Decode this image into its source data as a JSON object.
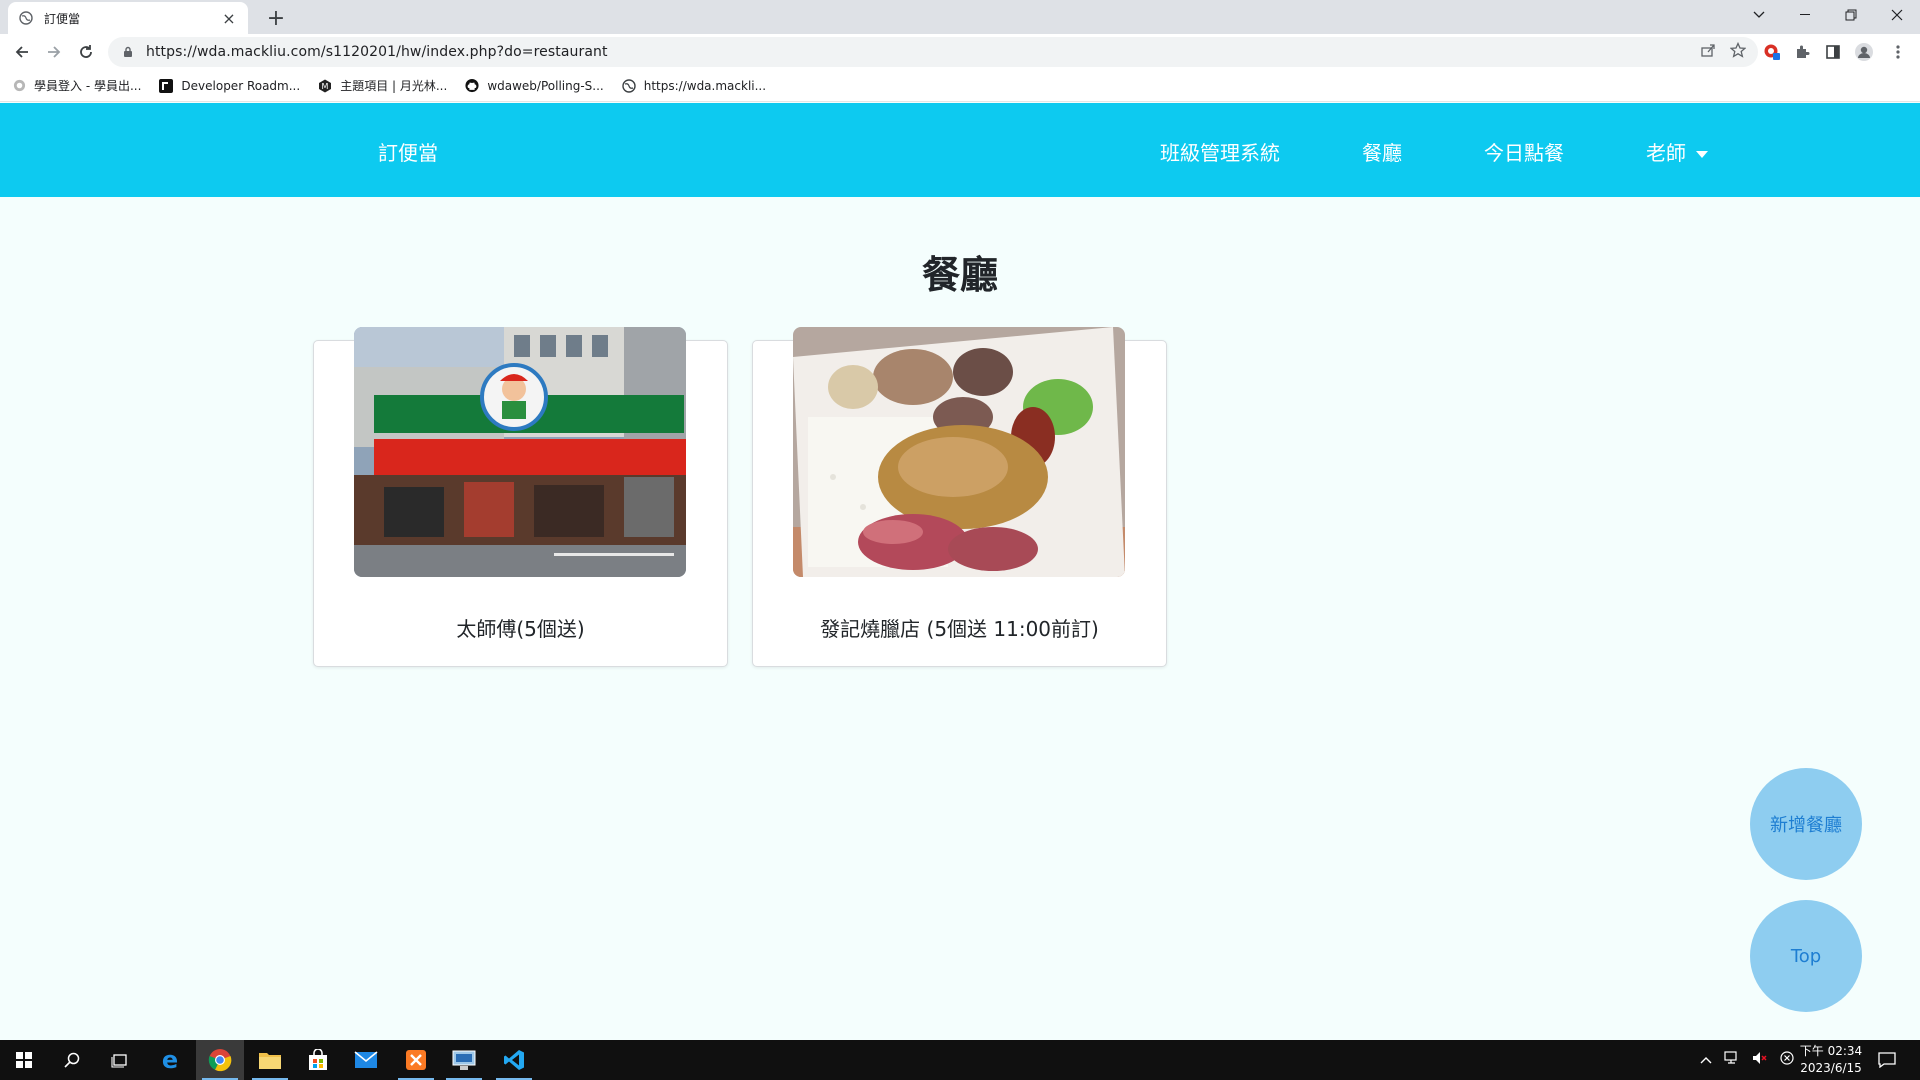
{
  "browser": {
    "tab_title": "訂便當",
    "tab_close": "×",
    "new_tab": "+",
    "url": "https://wda.mackliu.com/s1120201/hw/index.php?do=restaurant",
    "bookmarks": [
      {
        "label": "學員登入 - 學員出...",
        "icon": "globe-icon"
      },
      {
        "label": "Developer Roadm...",
        "icon": "roadmap-icon"
      },
      {
        "label": "主題項目 | 月光林...",
        "icon": "hexagon-icon"
      },
      {
        "label": "wdaweb/Polling-S...",
        "icon": "github-icon"
      },
      {
        "label": "https://wda.mackli...",
        "icon": "globe-icon"
      }
    ]
  },
  "site": {
    "brand": "訂便當",
    "nav": {
      "class_system": "班級管理系統",
      "restaurants": "餐廳",
      "today_order": "今日點餐",
      "teacher": "老師"
    },
    "page_title": "餐廳",
    "restaurants": [
      {
        "name": "太師傅(5個送)",
        "image": "storefront-photo"
      },
      {
        "name": "發記燒臘店 (5個送 11:00前訂)",
        "image": "bento-photo"
      }
    ],
    "fab_add": "新增餐廳",
    "fab_top": "Top"
  },
  "colors": {
    "navbar": "#0dcaf0",
    "page_bg": "#f4fefd",
    "fab_bg": "#8ecdf0",
    "fab_text": "#1e7ed2"
  },
  "taskbar": {
    "clock_time": "下午 02:34",
    "clock_date": "2023/6/15"
  }
}
